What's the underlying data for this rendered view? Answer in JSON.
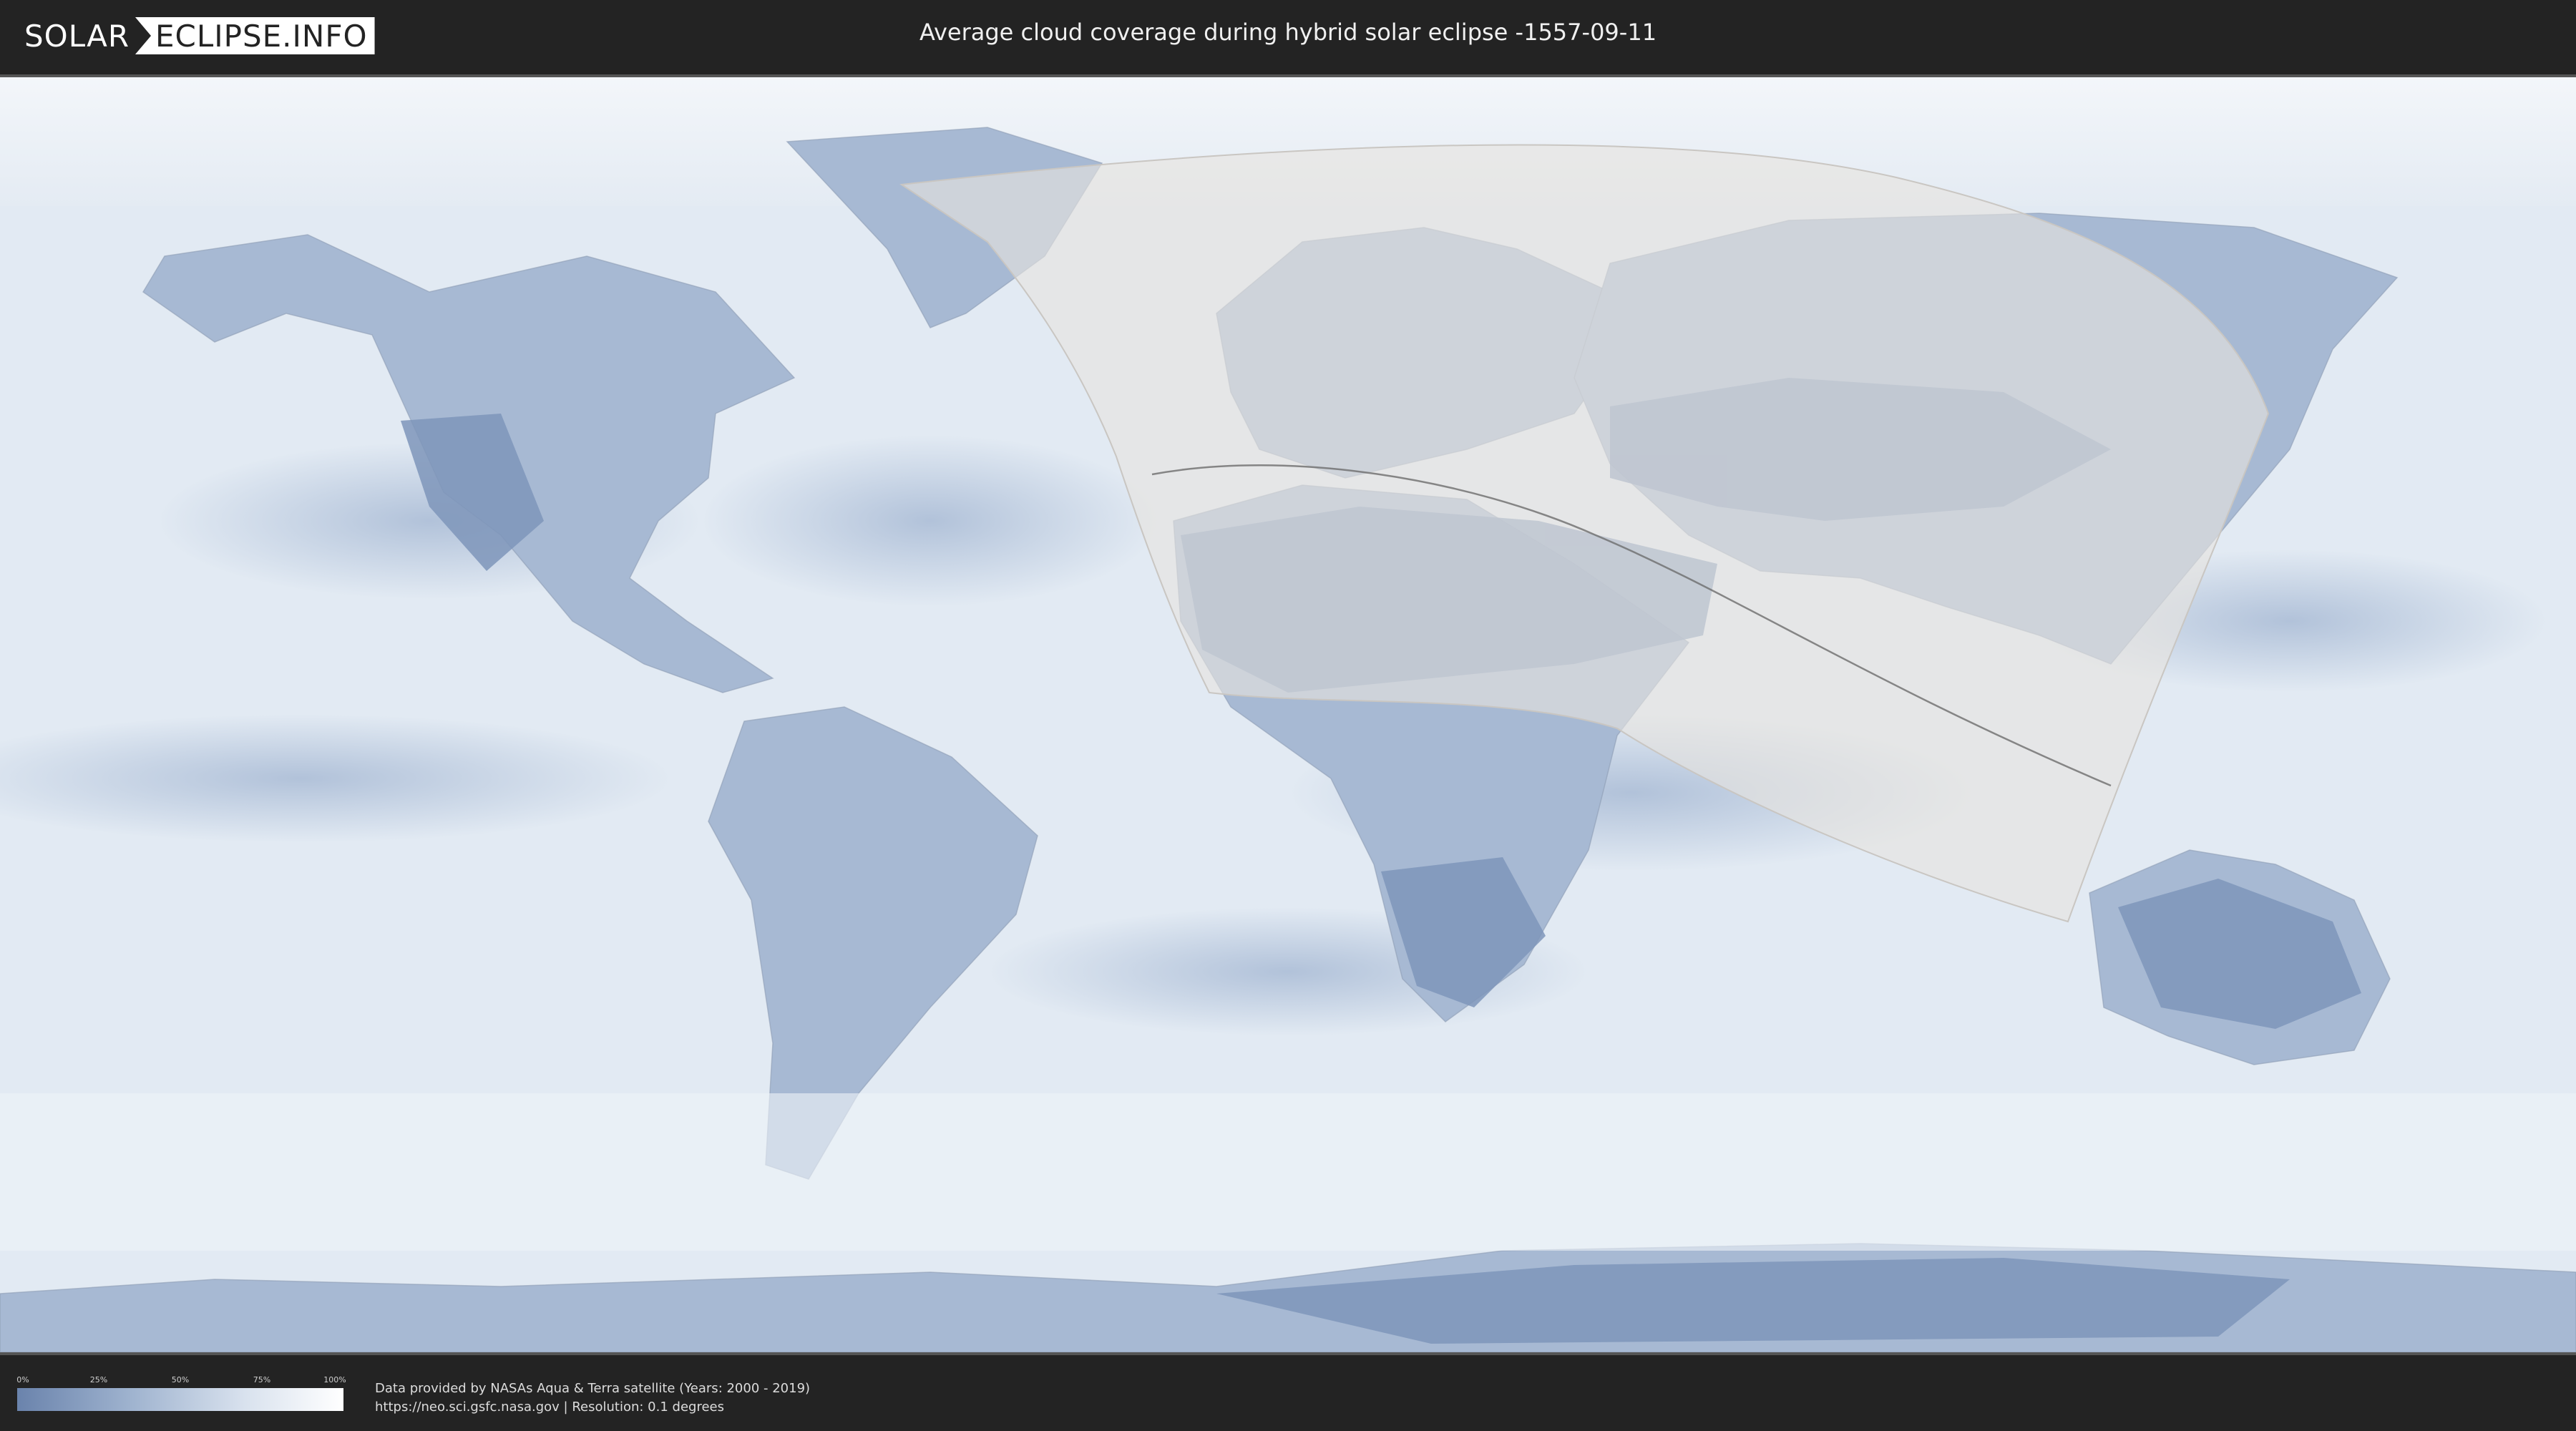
{
  "header": {
    "logo_left": "SOLAR",
    "logo_right": "ECLIPSE.INFO",
    "title": "Average cloud coverage during hybrid solar eclipse -1557-09-11"
  },
  "legend": {
    "labels": [
      "0%",
      "25%",
      "50%",
      "75%",
      "100%"
    ],
    "gradient_colors": [
      "#6a83ac",
      "#9fb3cf",
      "#d9e2ee",
      "#ffffff"
    ]
  },
  "footer": {
    "credit_line1": "Data provided by NASAs Aqua & Terra satellite (Years: 2000 - 2019)",
    "credit_line2": "https://neo.sci.gsfc.nasa.gov | Resolution: 0.1 degrees"
  },
  "map": {
    "projection": "equirectangular",
    "ocean_color": "#dfe8f2",
    "land_cloudfree_color": "#7e95ba",
    "eclipse_shadow_color": "#e6e3df",
    "eclipse_path_color": "#6d6d6d"
  }
}
